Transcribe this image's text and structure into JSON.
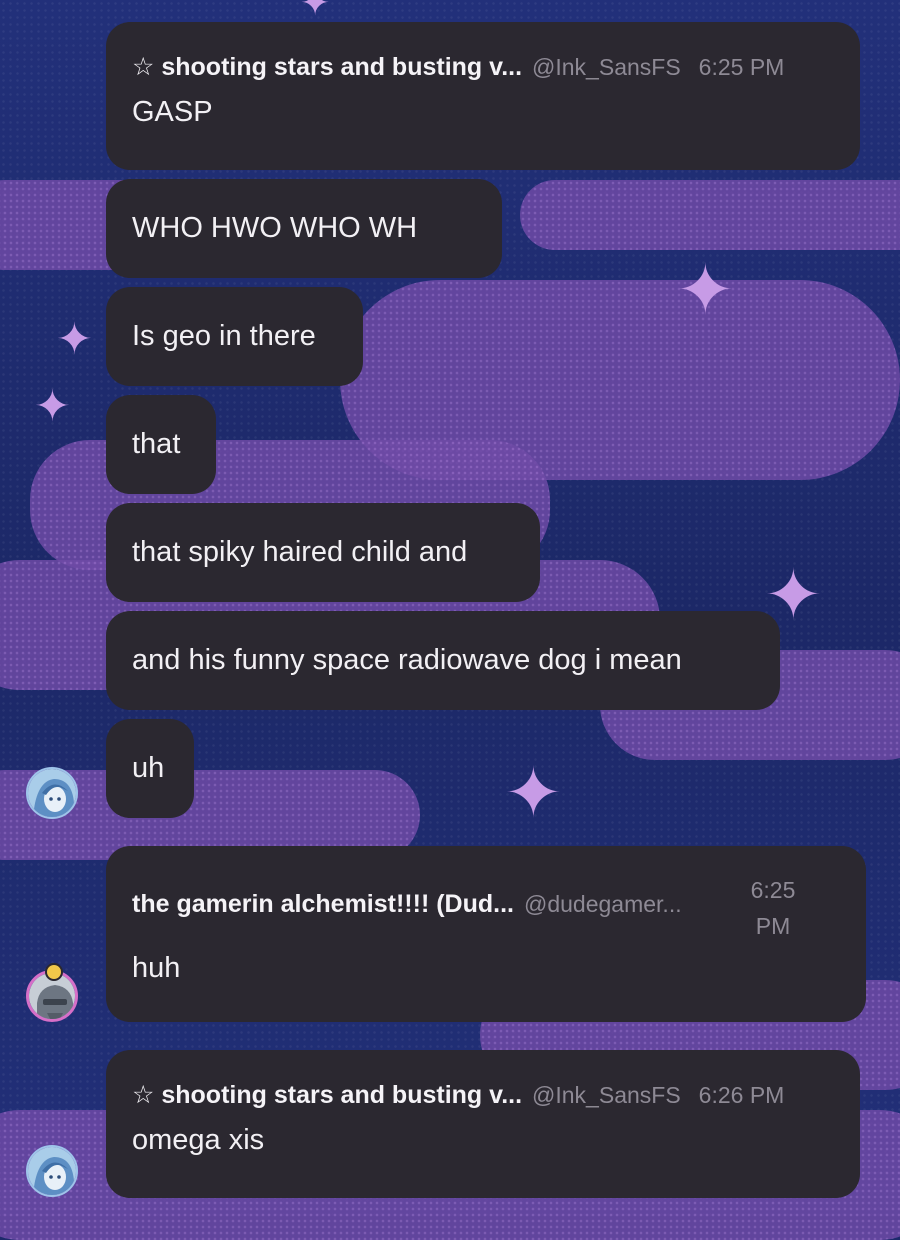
{
  "messages": [
    {
      "author": "☆ shooting stars and busting v...",
      "handle": "@Ink_SansFS",
      "time": "6:25 PM",
      "text": "GASP"
    },
    {
      "text": "WHO HWO WHO WH"
    },
    {
      "text": "Is geo in there"
    },
    {
      "text": "that"
    },
    {
      "text": "that spiky haired child and"
    },
    {
      "text": "and his funny space radiowave dog i mean"
    },
    {
      "text": "uh"
    },
    {
      "author": "the gamerin alchemist!!!! (Dud...",
      "handle": "@dudegamer...",
      "time_line1": "6:25",
      "time_line2": "PM",
      "text": "huh"
    },
    {
      "author": "☆ shooting stars and busting v...",
      "handle": "@Ink_SansFS",
      "time": "6:26 PM",
      "text": "omega xis"
    }
  ],
  "colors": {
    "bubble": "#2b2830",
    "background": "#1d2a6b",
    "cloud": "#6e4aa6",
    "sparkle": "#c79be6",
    "muted_text": "#8e8a95"
  },
  "icons": [
    "sparkle-icon",
    "avatar-blue-anime",
    "avatar-gray-armor",
    "crown-badge-icon"
  ]
}
